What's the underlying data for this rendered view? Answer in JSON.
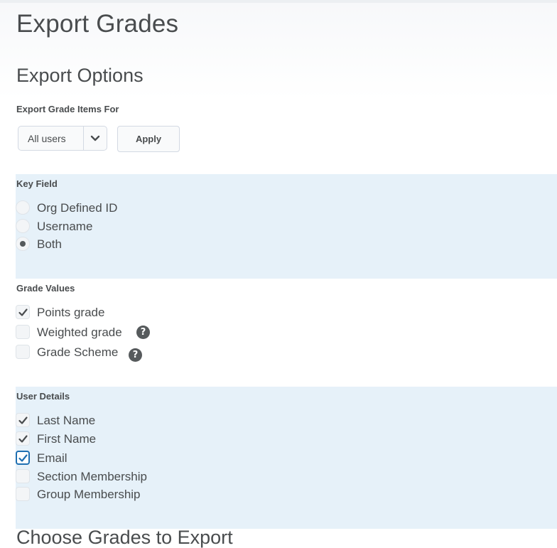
{
  "page": {
    "title": "Export Grades"
  },
  "export_options": {
    "heading": "Export Options",
    "grade_items_for": {
      "label": "Export Grade Items For",
      "selected": "All users",
      "apply_label": "Apply"
    }
  },
  "key_field": {
    "label": "Key Field",
    "options": [
      {
        "label": "Org Defined ID",
        "selected": false
      },
      {
        "label": "Username",
        "selected": false
      },
      {
        "label": "Both",
        "selected": true
      }
    ]
  },
  "grade_values": {
    "label": "Grade Values",
    "options": [
      {
        "label": "Points grade",
        "checked": true
      },
      {
        "label": "Weighted grade",
        "checked": false,
        "help": "?"
      },
      {
        "label": "Grade Scheme",
        "checked": false,
        "help": "?"
      }
    ]
  },
  "user_details": {
    "label": "User Details",
    "options": [
      {
        "label": "Last Name",
        "checked": true
      },
      {
        "label": "First Name",
        "checked": true
      },
      {
        "label": "Email",
        "checked": true,
        "focused": true
      },
      {
        "label": "Section Membership",
        "checked": false
      },
      {
        "label": "Group Membership",
        "checked": false
      }
    ]
  },
  "next_section": {
    "heading": "Choose Grades to Export"
  },
  "colors": {
    "panel": "#e6f1f9",
    "text": "#494c4e",
    "focus": "#1f6fb1"
  },
  "icons": {
    "dropdown": "chevron-down-icon",
    "help": "help-circle-icon",
    "check": "checkmark-icon"
  }
}
